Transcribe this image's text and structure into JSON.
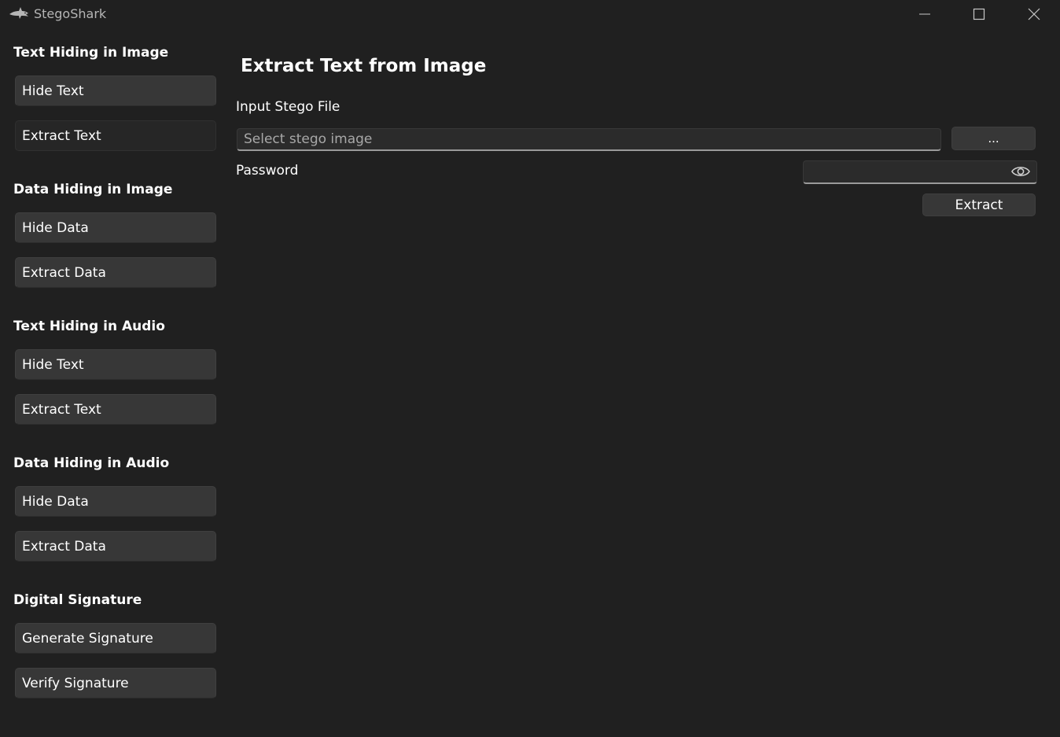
{
  "window": {
    "title": "StegoShark",
    "icon": "shark-icon",
    "controls": [
      "minimize-icon",
      "maximize-icon",
      "close-icon"
    ]
  },
  "sidebar": {
    "sections": [
      {
        "title": "Text Hiding in Image",
        "buttons": [
          "Hide Text",
          "Extract Text"
        ]
      },
      {
        "title": "Data Hiding in Image",
        "buttons": [
          "Hide Data",
          "Extract Data"
        ]
      },
      {
        "title": "Text Hiding in Audio",
        "buttons": [
          "Hide Text",
          "Extract Text"
        ]
      },
      {
        "title": "Data Hiding in Audio",
        "buttons": [
          "Hide Data",
          "Extract Data"
        ]
      },
      {
        "title": "Digital Signature",
        "buttons": [
          "Generate Signature",
          "Verify Signature"
        ]
      }
    ],
    "active": "Text Hiding in Image / Extract Text"
  },
  "main": {
    "title": "Extract Text from Image",
    "input_label": "Input Stego File",
    "input_placeholder": "Select stego image",
    "input_value": "",
    "browse_label": "...",
    "password_label": "Password",
    "password_value": "",
    "show_password_icon": "eye-icon",
    "extract_label": "Extract"
  },
  "colors": {
    "background": "#202020",
    "button": "#373737",
    "active_button": "#262626",
    "input": "#2b2b2b",
    "text": "#ffffff",
    "muted_text": "#a8a8a8"
  }
}
